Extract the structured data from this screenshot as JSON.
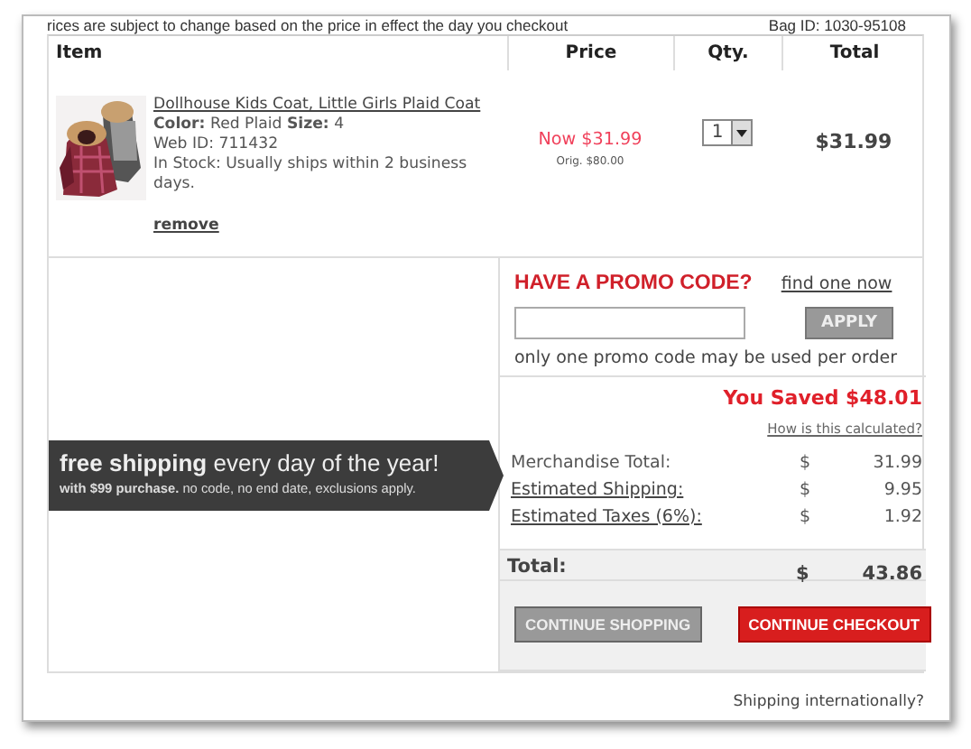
{
  "notice": {
    "text": "rices are subject to change based on the price in effect the day you checkout",
    "bag_id": "Bag ID: 1030-95108"
  },
  "columns": [
    "Item",
    "Price",
    "Qty.",
    "Total"
  ],
  "items": [
    {
      "kind": "picture",
      "name": "Dollhouse Kids Coat, Little Girls Plaid Coat",
      "color_label": "Color:",
      "color_value": "Red Plaid",
      "size_label": "Size:",
      "size": "4",
      "web_id": "Web ID: 711432",
      "stock": "In Stock: Usually ships within 2 business days.",
      "remove": "remove",
      "now_price": "Now $31.99",
      "orig_price": "Orig. $80.00",
      "qty": "1",
      "total": "$31.99"
    }
  ],
  "promo": {
    "title": "HAVE A PROMO CODE?",
    "link": "find one now",
    "apply": "APPLY",
    "note": "only one promo code may be used per order"
  },
  "summary": {
    "saved": "You Saved $48.01",
    "how": "How is this calculated?",
    "lines": [
      {
        "label": "Merchandise Total:",
        "link": false,
        "currency": "$",
        "amount": "31.99"
      },
      {
        "label": "Estimated Shipping:",
        "link": true,
        "currency": "$",
        "amount": "9.95"
      },
      {
        "label": "Estimated Taxes (6%):",
        "link": true,
        "currency": "$",
        "amount": "1.92"
      }
    ],
    "total": {
      "label": "Total:",
      "currency": "$",
      "amount": "43.86"
    }
  },
  "banner": {
    "headline": "**free shipping** every day of the year!",
    "subline": "**with $99 purchase.** no code, no end date, exclusions apply."
  },
  "buttons": [
    {
      "label": "CONTINUE SHOPPING",
      "kind": "secondary"
    },
    {
      "label": "CONTINUE CHECKOUT",
      "kind": "primary"
    }
  ],
  "footer_link": "Shipping internationally?"
}
